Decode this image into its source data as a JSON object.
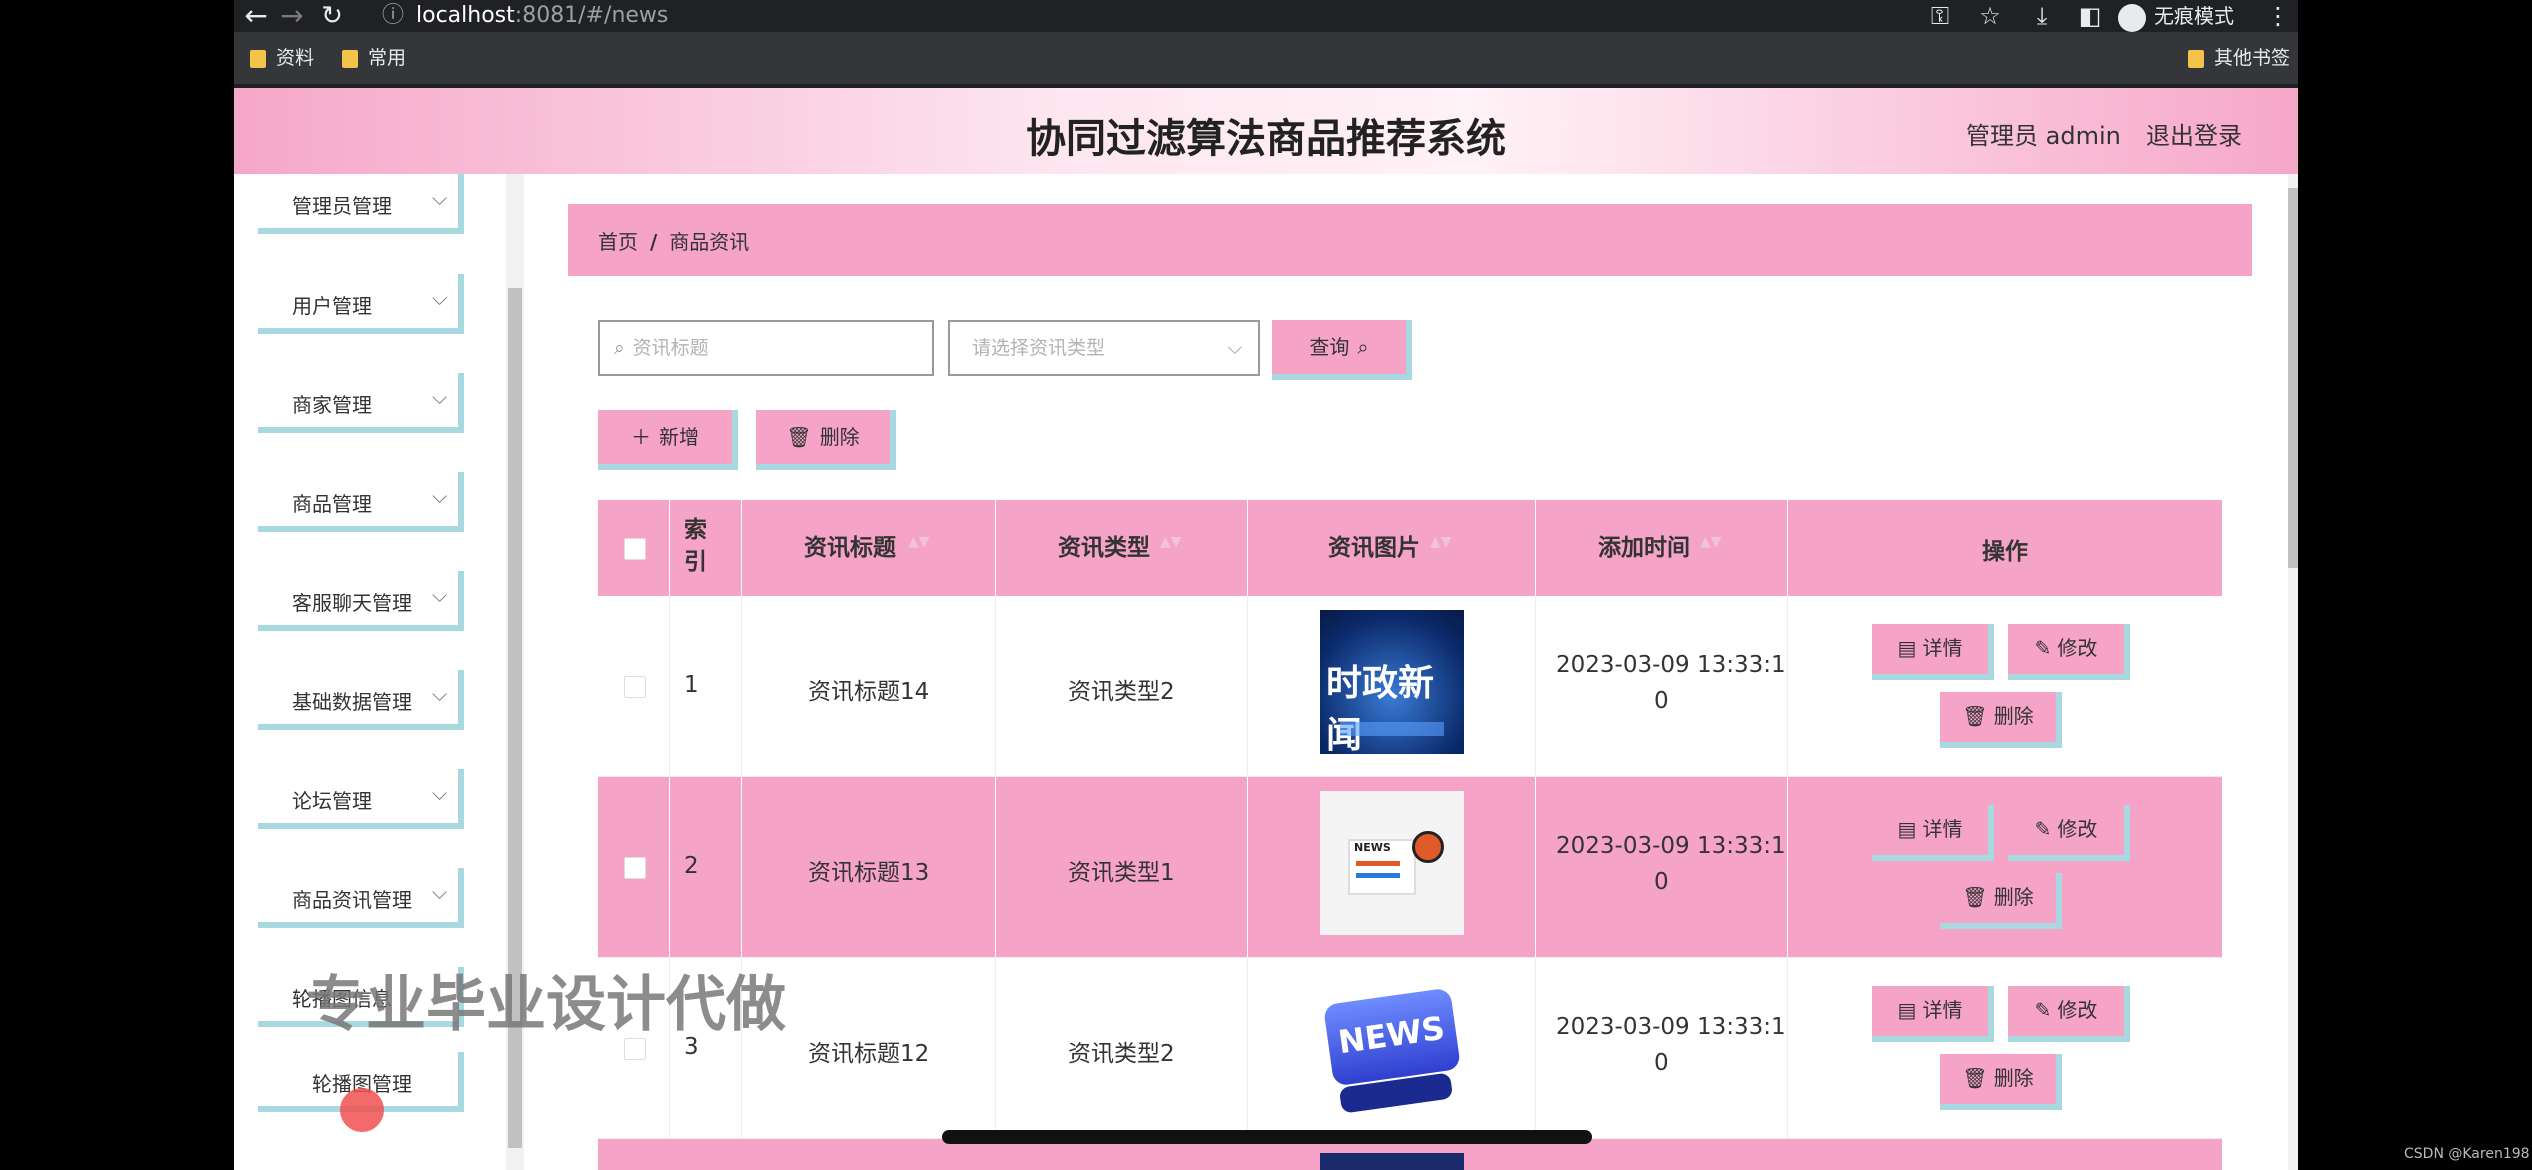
{
  "browser": {
    "url_host": "localhost",
    "url_rest": ":8081/#/news",
    "incognito_label": "无痕模式",
    "bookmarks": [
      "资料",
      "常用"
    ],
    "other_bookmarks": "其他书签"
  },
  "header": {
    "title": "协同过滤算法商品推荐系统",
    "admin": "管理员 admin",
    "logout": "退出登录"
  },
  "sidebar": {
    "items": [
      {
        "label": "管理员管理"
      },
      {
        "label": "用户管理"
      },
      {
        "label": "商家管理"
      },
      {
        "label": "商品管理"
      },
      {
        "label": "客服聊天管理"
      },
      {
        "label": "基础数据管理"
      },
      {
        "label": "论坛管理"
      },
      {
        "label": "商品资讯管理"
      },
      {
        "label": "轮播图信息"
      },
      {
        "label": "轮播图管理"
      }
    ]
  },
  "breadcrumb": {
    "home": "首页",
    "sep": "/",
    "current": "商品资讯"
  },
  "search": {
    "title_placeholder": "资讯标题",
    "type_placeholder": "请选择资讯类型",
    "query_label": "查询"
  },
  "toolbar": {
    "add_label": "新增",
    "delete_label": "删除"
  },
  "table": {
    "headers": {
      "index": "索引",
      "title": "资讯标题",
      "type": "资讯类型",
      "image": "资讯图片",
      "time": "添加时间",
      "ops": "操作"
    },
    "rows": [
      {
        "index": "1",
        "title": "资讯标题14",
        "type": "资讯类型2",
        "time_a": "2023-03-09 13:33:1",
        "time_b": "0",
        "image": "时政新闻"
      },
      {
        "index": "2",
        "title": "资讯标题13",
        "type": "资讯类型1",
        "time_a": "2023-03-09 13:33:1",
        "time_b": "0",
        "image": "NEWS"
      },
      {
        "index": "3",
        "title": "资讯标题12",
        "type": "资讯类型2",
        "time_a": "2023-03-09 13:33:1",
        "time_b": "0",
        "image": "NEWS"
      }
    ],
    "actions": {
      "detail": "详情",
      "edit": "修改",
      "delete": "删除"
    }
  },
  "overlay": {
    "watermark": "专业毕业设计代做",
    "credit": "CSDN @Karen198"
  },
  "colors": {
    "accent_pink": "#f5a3c6",
    "border_blue": "#a8d8e0"
  }
}
